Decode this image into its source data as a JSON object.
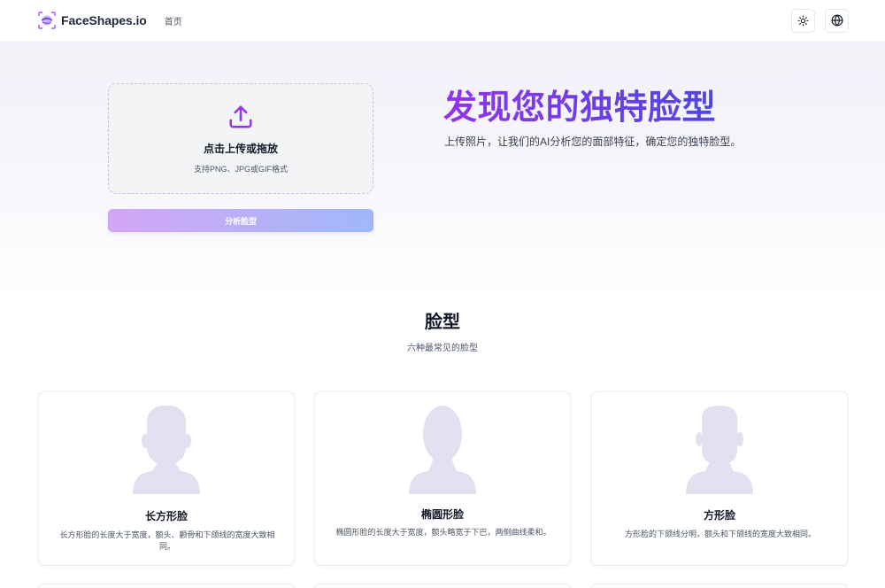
{
  "header": {
    "brand": "FaceShapes.io",
    "nav_home": "首页",
    "theme_icon": "sun-icon",
    "language_icon": "globe-icon"
  },
  "hero": {
    "upload_title": "点击上传或拖放",
    "upload_hint": "支持PNG、JPG或GIF格式",
    "analyze_button": "分析脸型",
    "title": "发现您的独特脸型",
    "subtitle": "上传照片，让我们的AI分析您的面部特征，确定您的独特脸型。"
  },
  "shapes_section": {
    "title": "脸型",
    "subtitle": "六种最常见的脸型",
    "cards": [
      {
        "title": "长方形脸",
        "description": "长方形脸的长度大于宽度，额头、颧骨和下颌线的宽度大致相同。",
        "icon": "avatar-silhouette-icon"
      },
      {
        "title": "椭圆形脸",
        "description": "椭圆形脸的长度大于宽度，额头略宽于下巴，两侧曲线柔和。",
        "icon": "avatar-silhouette-icon"
      },
      {
        "title": "方形脸",
        "description": "方形脸的下颌线分明，额头和下颌线的宽度大致相同。",
        "icon": "avatar-silhouette-icon"
      }
    ]
  },
  "colors": {
    "brand_gradient_start": "#9333ea",
    "brand_gradient_end": "#4f46e5",
    "button_gradient_start": "#d4a6f5",
    "button_gradient_end": "#9fb8f9",
    "silhouette": "#e2e1f1"
  }
}
